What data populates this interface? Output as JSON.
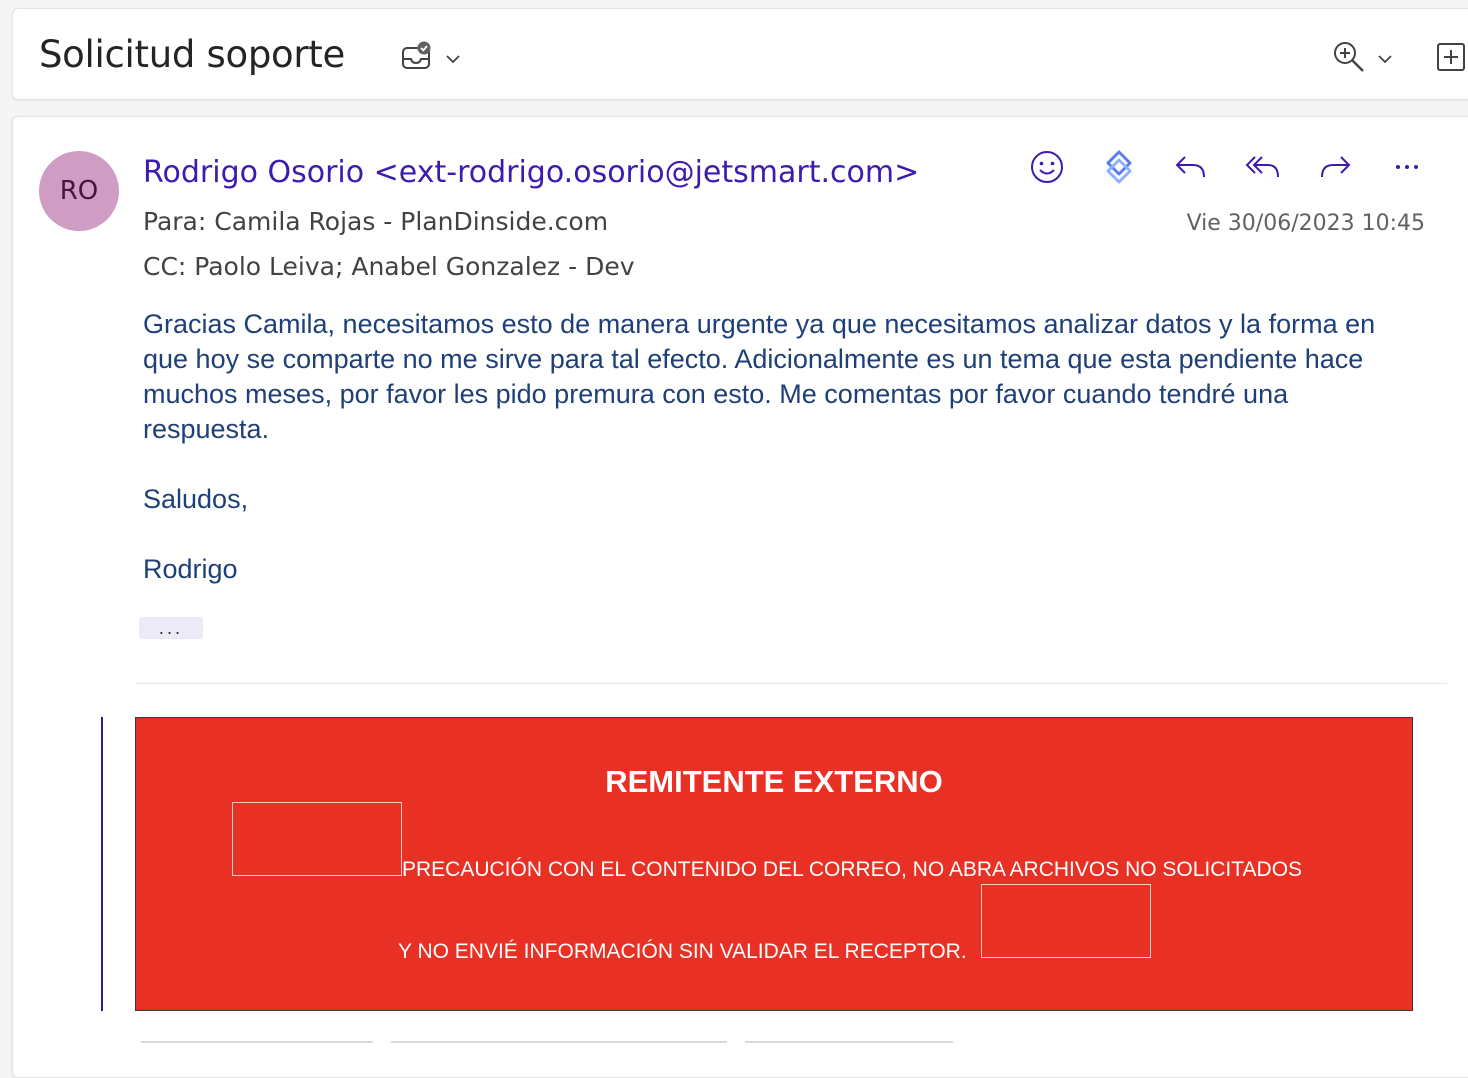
{
  "header": {
    "subject": "Solicitud soporte"
  },
  "message": {
    "avatar_initials": "RO",
    "sender": "Rodrigo Osorio <ext-rodrigo.osorio@jetsmart.com>",
    "to_line": "Para:  Camila Rojas - PlanDinside.com",
    "cc_line": "CC:  Paolo Leiva;  Anabel Gonzalez - Dev",
    "date": "Vie 30/06/2023 10:45",
    "body_paragraph": "Gracias Camila, necesitamos esto de manera urgente ya que necesitamos analizar datos  y la forma en que hoy se comparte no me sirve para tal efecto. Adicionalmente es un tema que esta pendiente hace muchos meses, por favor les pido premura con esto. Me comentas por favor cuando tendré una respuesta.",
    "greeting": "Saludos,",
    "signature": "Rodrigo",
    "more_label": "...",
    "actions": [
      "smile-icon",
      "loop-icon",
      "reply-icon",
      "reply-all-icon",
      "forward-icon",
      "more-icon"
    ]
  },
  "banner": {
    "title": "REMITENTE EXTERNO",
    "line1": "PRECAUCIÓN CON EL CONTENIDO DEL CORREO, NO ABRA ARCHIVOS NO SOLICITADOS",
    "line2": "Y NO ENVIÉ INFORMACIÓN SIN VALIDAR EL RECEPTOR."
  },
  "colors": {
    "accent": "#3d1bb0",
    "body_text": "#1f3f78",
    "banner_bg": "#e83024",
    "avatar_bg": "#cf9cc4"
  }
}
